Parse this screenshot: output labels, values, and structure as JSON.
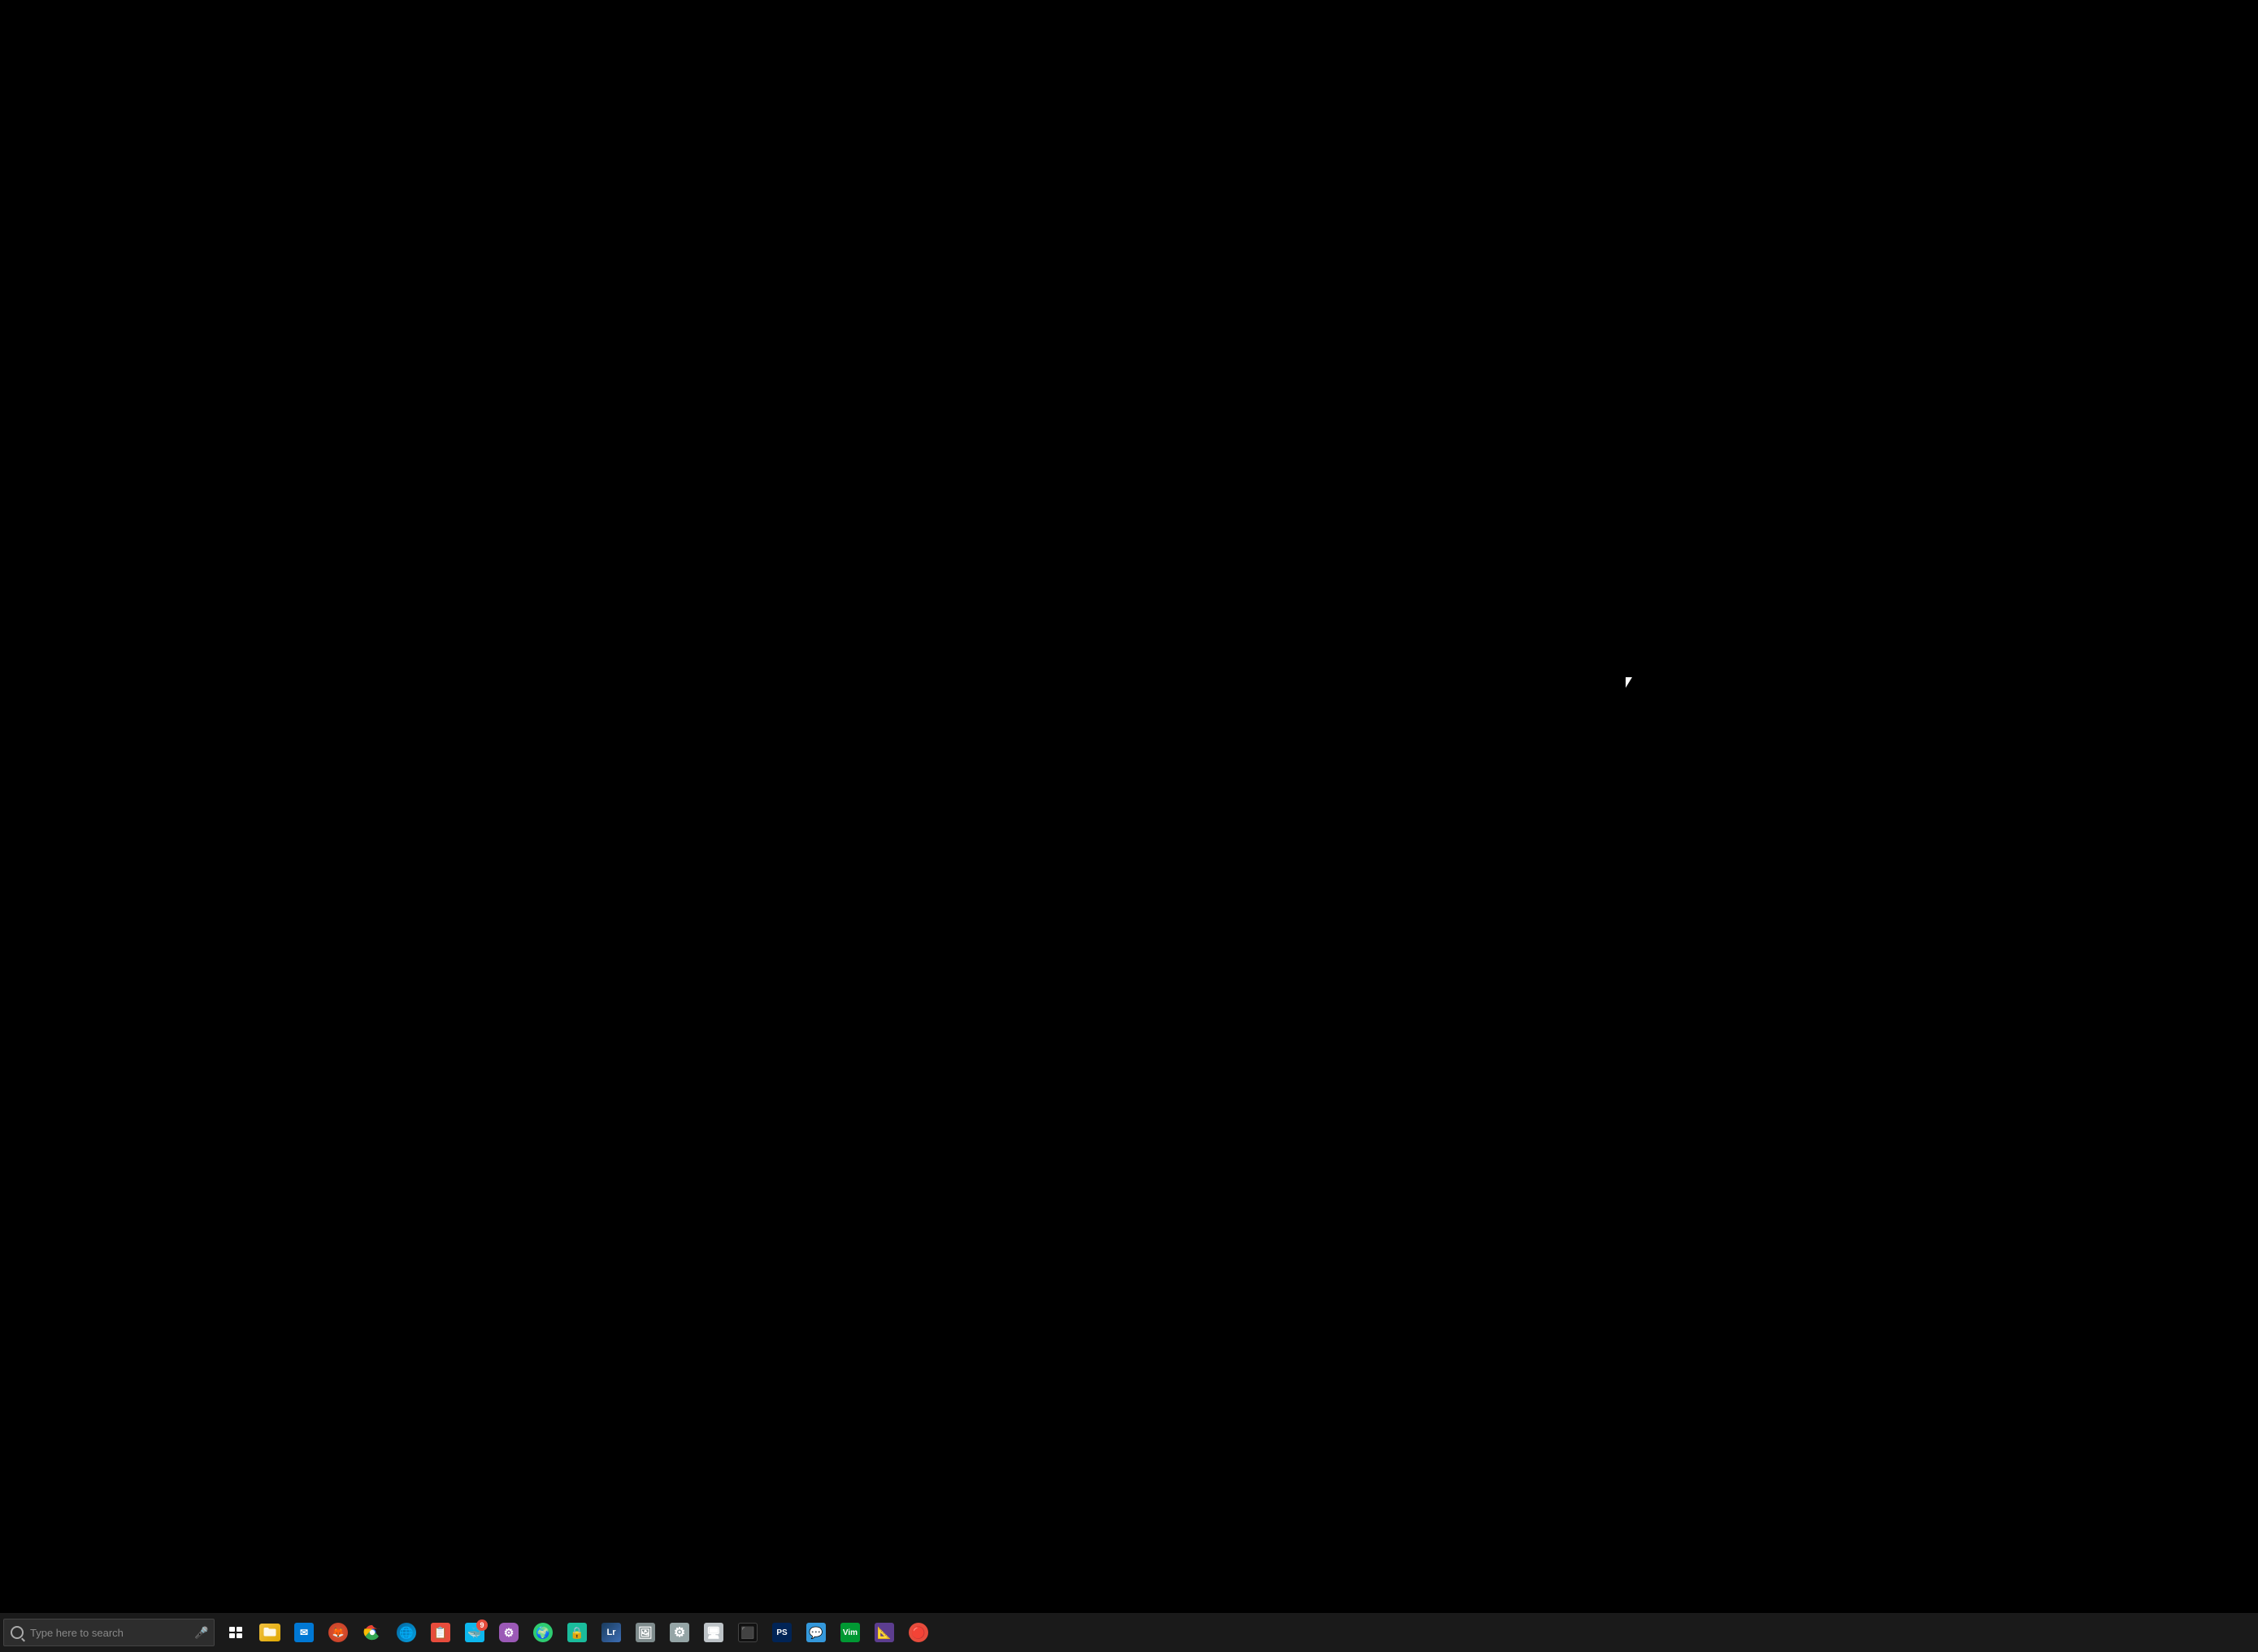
{
  "desktop": {
    "background_color": "#000000"
  },
  "taskbar": {
    "background_color": "#1a1a1a",
    "search": {
      "placeholder": "Type here to search",
      "value": ""
    },
    "icons": [
      {
        "name": "task-view",
        "label": "Task View",
        "color": "#ffffff"
      },
      {
        "name": "file-explorer",
        "label": "File Explorer",
        "color": "#f0a500"
      },
      {
        "name": "mail",
        "label": "Mail",
        "color": "#0078d4"
      },
      {
        "name": "firefox",
        "label": "Firefox",
        "color": "#e55b2b"
      },
      {
        "name": "chrome",
        "label": "Chrome",
        "color": "#4285f4"
      },
      {
        "name": "edge",
        "label": "Microsoft Edge",
        "color": "#0078d4"
      },
      {
        "name": "wunderlust",
        "label": "Wunderlist",
        "color": "#e74c3c"
      },
      {
        "name": "docker",
        "label": "Docker",
        "color": "#0db7ed"
      },
      {
        "name": "unknown1",
        "label": "App",
        "color": "#9b59b6"
      },
      {
        "name": "unknown2",
        "label": "App",
        "color": "#2ecc71"
      },
      {
        "name": "keeper",
        "label": "Keeper",
        "color": "#1abc9c"
      },
      {
        "name": "lightroom",
        "label": "Lightroom",
        "color": "#3d6eb5"
      },
      {
        "name": "unknown3",
        "label": "App",
        "color": "#7f8c8d"
      },
      {
        "name": "settings",
        "label": "Settings",
        "color": "#95a5a6"
      },
      {
        "name": "unknown4",
        "label": "App",
        "color": "#bdc3c7"
      },
      {
        "name": "terminal",
        "label": "Terminal",
        "color": "#2c3e50"
      },
      {
        "name": "powershell",
        "label": "PowerShell",
        "color": "#012456"
      },
      {
        "name": "unknown5",
        "label": "App",
        "color": "#3498db"
      },
      {
        "name": "vim",
        "label": "Vim",
        "color": "#019833"
      },
      {
        "name": "vscode",
        "label": "VS Code / Vectorize",
        "color": "#5c3d8f"
      },
      {
        "name": "unknown6",
        "label": "App",
        "color": "#e74c3c"
      }
    ],
    "notification_badge": "9"
  }
}
